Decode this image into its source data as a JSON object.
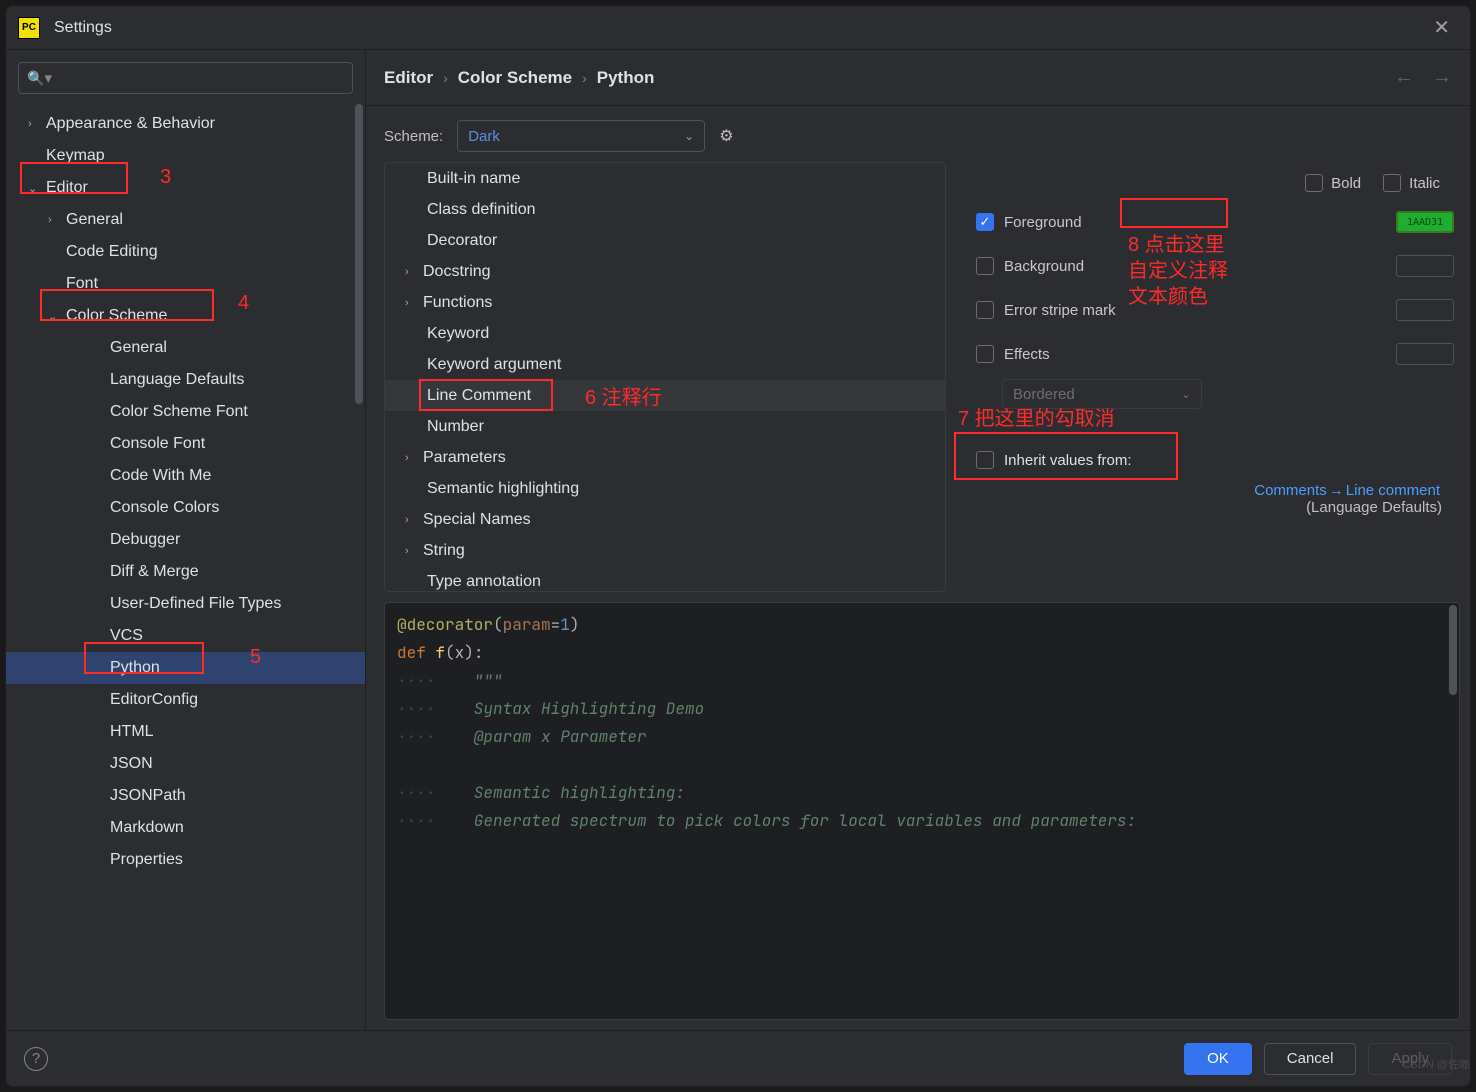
{
  "window": {
    "title": "Settings"
  },
  "search": {
    "placeholder": ""
  },
  "breadcrumbs": [
    "Editor",
    "Color Scheme",
    "Python"
  ],
  "scheme": {
    "label": "Scheme:",
    "value": "Dark"
  },
  "sidebar": {
    "items": [
      {
        "label": "Appearance & Behavior",
        "arrow": "collapsed",
        "level": 1
      },
      {
        "label": "Keymap",
        "arrow": "none",
        "level": 1
      },
      {
        "label": "Editor",
        "arrow": "expanded",
        "level": 1
      },
      {
        "label": "General",
        "arrow": "collapsed",
        "level": 2
      },
      {
        "label": "Code Editing",
        "arrow": "none",
        "level": 2
      },
      {
        "label": "Font",
        "arrow": "none",
        "level": 2
      },
      {
        "label": "Color Scheme",
        "arrow": "expanded",
        "level": 2
      },
      {
        "label": "General",
        "arrow": "none",
        "level": 3
      },
      {
        "label": "Language Defaults",
        "arrow": "none",
        "level": 3
      },
      {
        "label": "Color Scheme Font",
        "arrow": "none",
        "level": 3
      },
      {
        "label": "Console Font",
        "arrow": "none",
        "level": 3
      },
      {
        "label": "Code With Me",
        "arrow": "none",
        "level": 3
      },
      {
        "label": "Console Colors",
        "arrow": "none",
        "level": 3
      },
      {
        "label": "Debugger",
        "arrow": "none",
        "level": 3
      },
      {
        "label": "Diff & Merge",
        "arrow": "none",
        "level": 3
      },
      {
        "label": "User-Defined File Types",
        "arrow": "none",
        "level": 3
      },
      {
        "label": "VCS",
        "arrow": "none",
        "level": 3
      },
      {
        "label": "Python",
        "arrow": "none",
        "level": 3,
        "selected": true
      },
      {
        "label": "EditorConfig",
        "arrow": "none",
        "level": 3
      },
      {
        "label": "HTML",
        "arrow": "none",
        "level": 3
      },
      {
        "label": "JSON",
        "arrow": "none",
        "level": 3
      },
      {
        "label": "JSONPath",
        "arrow": "none",
        "level": 3
      },
      {
        "label": "Markdown",
        "arrow": "none",
        "level": 3
      },
      {
        "label": "Properties",
        "arrow": "none",
        "level": 3
      }
    ]
  },
  "attrs": [
    {
      "label": "Built-in name",
      "arrow": "none"
    },
    {
      "label": "Class definition",
      "arrow": "none"
    },
    {
      "label": "Decorator",
      "arrow": "none"
    },
    {
      "label": "Docstring",
      "arrow": "collapsed"
    },
    {
      "label": "Functions",
      "arrow": "collapsed"
    },
    {
      "label": "Keyword",
      "arrow": "none"
    },
    {
      "label": "Keyword argument",
      "arrow": "none"
    },
    {
      "label": "Line Comment",
      "arrow": "none",
      "selected": true
    },
    {
      "label": "Number",
      "arrow": "none"
    },
    {
      "label": "Parameters",
      "arrow": "collapsed"
    },
    {
      "label": "Semantic highlighting",
      "arrow": "none"
    },
    {
      "label": "Special Names",
      "arrow": "collapsed"
    },
    {
      "label": "String",
      "arrow": "collapsed"
    },
    {
      "label": "Type annotation",
      "arrow": "none"
    }
  ],
  "style": {
    "bold": "Bold",
    "italic": "Italic",
    "foreground": "Foreground",
    "fg_hex": "1AAD31",
    "background": "Background",
    "error_stripe": "Error stripe mark",
    "effects": "Effects",
    "effects_type": "Bordered",
    "inherit": "Inherit values from:",
    "inherit_link_a": "Comments",
    "inherit_link_b": "Line comment",
    "inherit_sub": "(Language Defaults)"
  },
  "annotations": {
    "n3": "3",
    "n4": "4",
    "n5": "5",
    "n6": "6 注释行",
    "n7": "7 把这里的勾取消",
    "n8": "8 点击这里自定义注释文本颜色"
  },
  "preview": {
    "l1_a": "@decorator",
    "l1_b": "(",
    "l1_c": "param",
    "l1_d": "=",
    "l1_e": "1",
    "l1_f": ")",
    "l2_a": "def ",
    "l2_b": "f",
    "l2_c": "(x):",
    "l3": "    \"\"\"",
    "l4": "    Syntax Highlighting Demo",
    "l5": "    @param x Parameter",
    "l6": "",
    "l7": "    Semantic highlighting:",
    "l8": "    Generated spectrum to pick colors for local variables and parameters:"
  },
  "buttons": {
    "ok": "OK",
    "cancel": "Cancel",
    "apply": "Apply"
  },
  "watermark": "CSDN @佐咖"
}
